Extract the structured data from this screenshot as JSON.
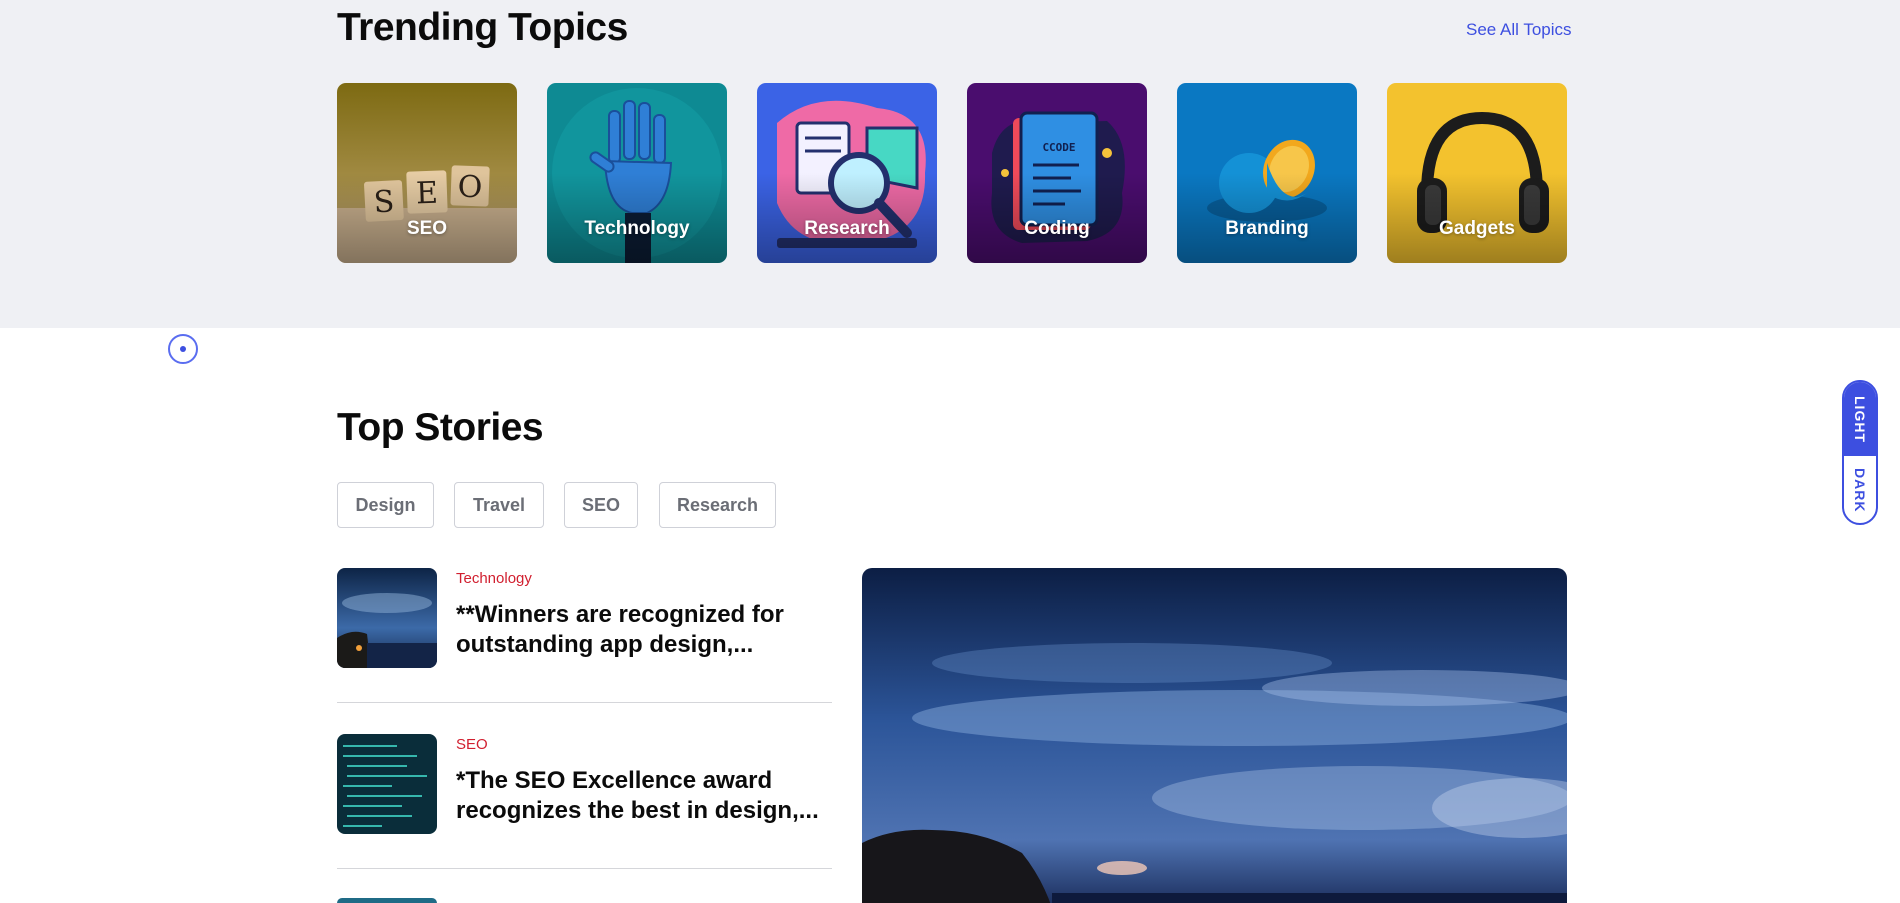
{
  "trending": {
    "title": "Trending Topics",
    "see_all": "See All Topics",
    "topics": [
      {
        "label": "SEO",
        "icon": "seo-scrabble-tiles"
      },
      {
        "label": "Technology",
        "icon": "robot-hand"
      },
      {
        "label": "Research",
        "icon": "magnifier-lab"
      },
      {
        "label": "Coding",
        "icon": "code-document"
      },
      {
        "label": "Branding",
        "icon": "orange-fruit"
      },
      {
        "label": "Gadgets",
        "icon": "headphones"
      }
    ]
  },
  "top_stories": {
    "title": "Top Stories",
    "filters": [
      "Design",
      "Travel",
      "SEO",
      "Research"
    ],
    "items": [
      {
        "category": "Technology",
        "headline": "**Winners are recognized for outstanding app design,..."
      },
      {
        "category": "SEO",
        "headline": "*The SEO Excellence award recognizes the best in design,..."
      }
    ]
  },
  "theme_toggle": {
    "light": "LIGHT",
    "dark": "DARK"
  },
  "colors": {
    "accent": "#3d4fe0",
    "category": "#d11f2f",
    "section_bg": "#eff0f4"
  }
}
